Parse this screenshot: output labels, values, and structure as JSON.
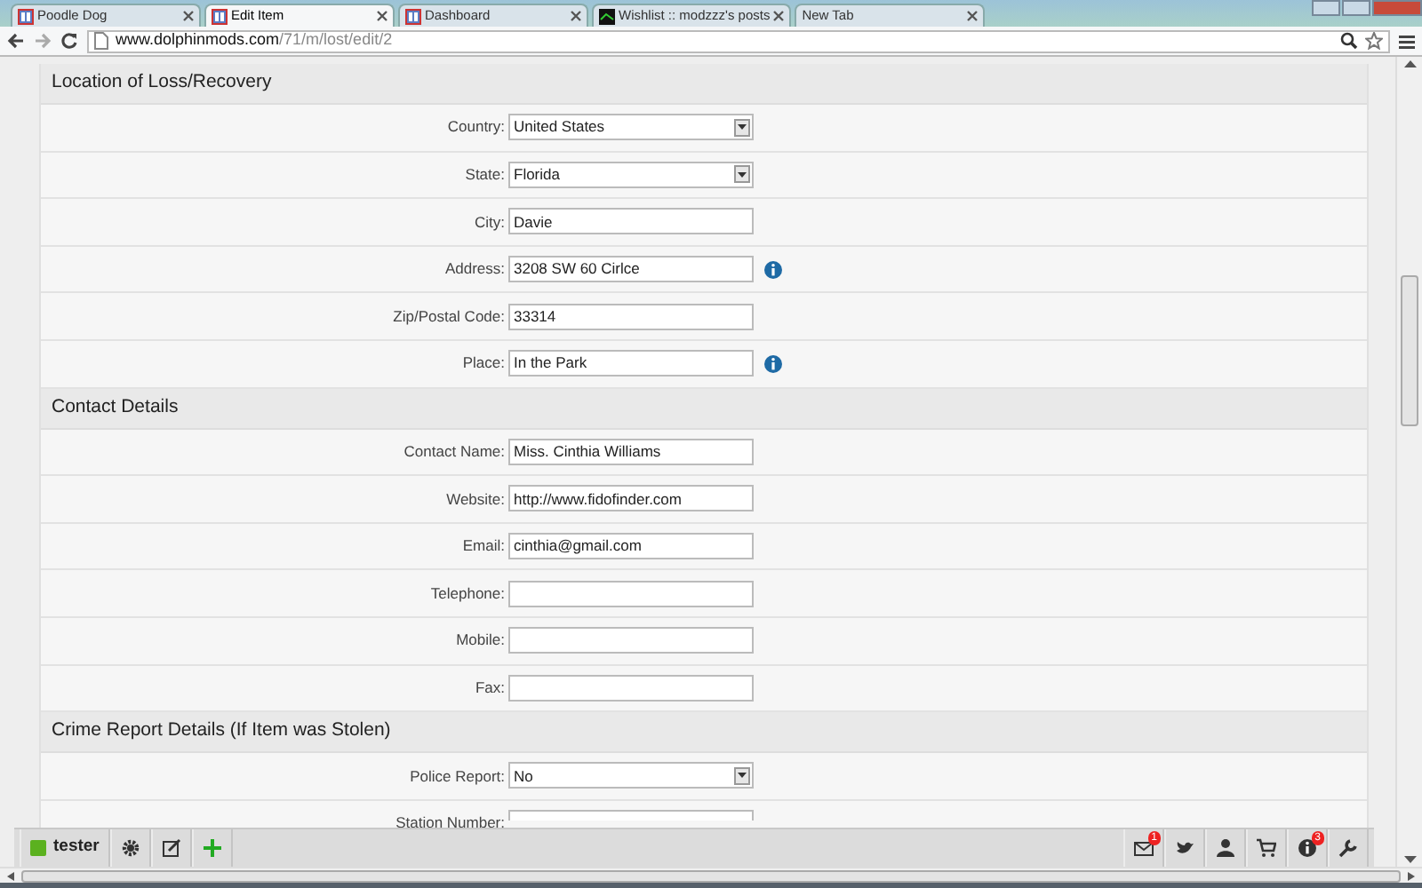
{
  "browser_tabs": [
    {
      "title": "Poodle Dog",
      "selected": false
    },
    {
      "title": "Edit Item",
      "selected": true
    },
    {
      "title": "Dashboard",
      "selected": false
    },
    {
      "title": "Wishlist :: modzzz's posts",
      "selected": false
    },
    {
      "title": "New Tab",
      "selected": false
    }
  ],
  "address_bar": {
    "host": "www.dolphinmods.com",
    "path": "/71/m/lost/edit/2"
  },
  "sections": [
    {
      "title": "Location of Loss/Recovery",
      "fields": [
        {
          "label": "Country:",
          "kind": "select",
          "value": "United States",
          "info": false
        },
        {
          "label": "State:",
          "kind": "select",
          "value": "Florida",
          "info": false
        },
        {
          "label": "City:",
          "kind": "text",
          "value": "Davie",
          "info": false
        },
        {
          "label": "Address:",
          "kind": "text",
          "value": "3208 SW 60 Cirlce",
          "info": true
        },
        {
          "label": "Zip/Postal Code:",
          "kind": "text",
          "value": "33314",
          "info": false
        },
        {
          "label": "Place:",
          "kind": "text",
          "value": "In the Park",
          "info": true
        }
      ]
    },
    {
      "title": "Contact Details",
      "fields": [
        {
          "label": "Contact Name:",
          "kind": "text",
          "value": "Miss. Cinthia Williams",
          "info": false
        },
        {
          "label": "Website:",
          "kind": "text",
          "value": "http://www.fidofinder.com",
          "info": false
        },
        {
          "label": "Email:",
          "kind": "text",
          "value": "cinthia@gmail.com",
          "info": false
        },
        {
          "label": "Telephone:",
          "kind": "text",
          "info": false
        },
        {
          "label": "Mobile:",
          "kind": "text",
          "info": false
        },
        {
          "label": "Fax:",
          "kind": "text",
          "info": false
        }
      ]
    },
    {
      "title": "Crime Report Details (If Item was Stolen)",
      "fields": [
        {
          "label": "Police Report:",
          "kind": "select",
          "value": "No",
          "info": false
        },
        {
          "label": "Station Number:",
          "kind": "text",
          "info": false
        }
      ]
    }
  ],
  "toolbar": {
    "user": "tester",
    "mail_badge": "1",
    "notice_badge": "3"
  }
}
